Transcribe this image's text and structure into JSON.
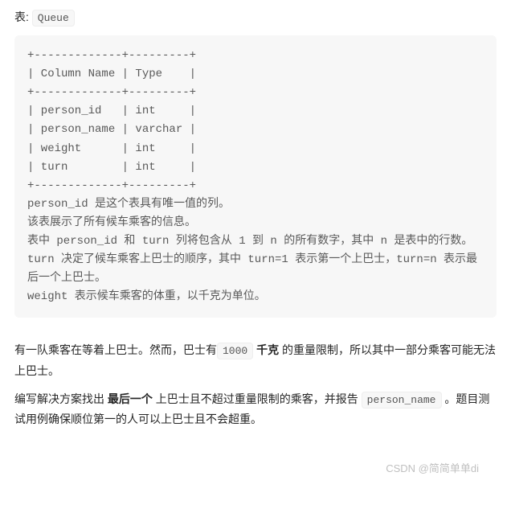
{
  "intro": {
    "prefix": "表: ",
    "table_name": "Queue"
  },
  "schema": {
    "border_top": "+-------------+---------+",
    "header": "| Column Name | Type    |",
    "border_mid": "+-------------+---------+",
    "rows": [
      "| person_id   | int     |",
      "| person_name | varchar |",
      "| weight      | int     |",
      "| turn        | int     |"
    ],
    "border_bot": "+-------------+---------+",
    "desc_lines": [
      "person_id 是这个表具有唯一值的列。",
      "该表展示了所有候车乘客的信息。",
      "表中 person_id 和 turn 列将包含从 1 到 n 的所有数字，其中 n 是表中的行数。",
      "turn 决定了候车乘客上巴士的顺序，其中 turn=1 表示第一个上巴士，turn=n 表示最后一个上巴士。",
      "weight 表示候车乘客的体重，以千克为单位。"
    ]
  },
  "body": {
    "p1_a": "有一队乘客在等着上巴士。然而，巴士有",
    "p1_code": "1000",
    "p1_b_bold": " 千克 ",
    "p1_c": "的重量限制，所以其中一部分乘客可能无法上巴士。",
    "p2_a": "编写解决方案找出 ",
    "p2_bold": "最后一个",
    "p2_b": " 上巴士且不超过重量限制的乘客，并报告 ",
    "p2_code": "person_name",
    "p2_c": " 。题目测试用例确保顺位第一的人可以上巴士且不会超重。"
  },
  "watermark": "CSDN @简简单单di"
}
